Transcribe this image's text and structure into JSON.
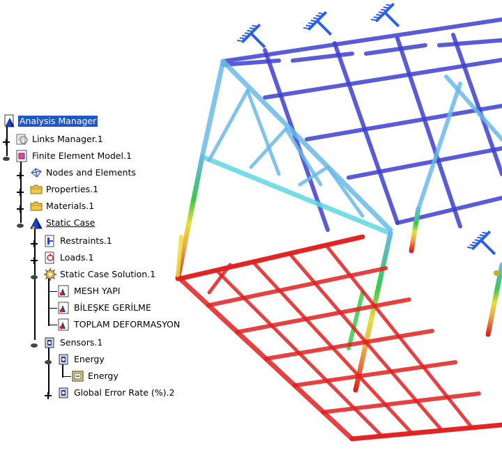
{
  "tree": {
    "root_label": "Analysis Manager",
    "links_manager": "Links Manager.1",
    "fem": "Finite Element Model.1",
    "nodes_elements": "Nodes and Elements",
    "properties": "Properties.1",
    "materials": "Materials.1",
    "static_case": "Static Case",
    "restraints": "Restraints.1",
    "loads": "Loads.1",
    "static_solution": "Static Case Solution.1",
    "mesh": "MESH YAPI",
    "stress": "BİLEŞKE GERİLME",
    "deformation": "TOPLAM DEFORMASYON",
    "sensors": "Sensors.1",
    "energy_folder": "Energy",
    "energy_item": "Energy",
    "error_rate": "Global Error Rate (%).2"
  },
  "colors": {
    "selection": "#1f57c4",
    "frame_blue": "#3d3fd0",
    "frame_light_blue": "#6ab8e8",
    "frame_cyan": "#5ed6e0",
    "frame_green": "#38c94a",
    "frame_yellow": "#e8df3a",
    "frame_orange": "#f0a24a",
    "frame_red": "#e02020",
    "restraint_blue": "#2a60e8"
  },
  "icons": {
    "root": "analysis-document-icon",
    "links": "links-manager-icon",
    "fem": "finite-element-model-icon",
    "nodes": "nodes-elements-icon",
    "folder": "folder-icon",
    "static_case": "static-case-icon",
    "restraints": "restraint-icon",
    "loads": "load-icon",
    "solution": "solution-gear-icon",
    "image": "result-image-icon",
    "sensor": "sensor-icon"
  }
}
